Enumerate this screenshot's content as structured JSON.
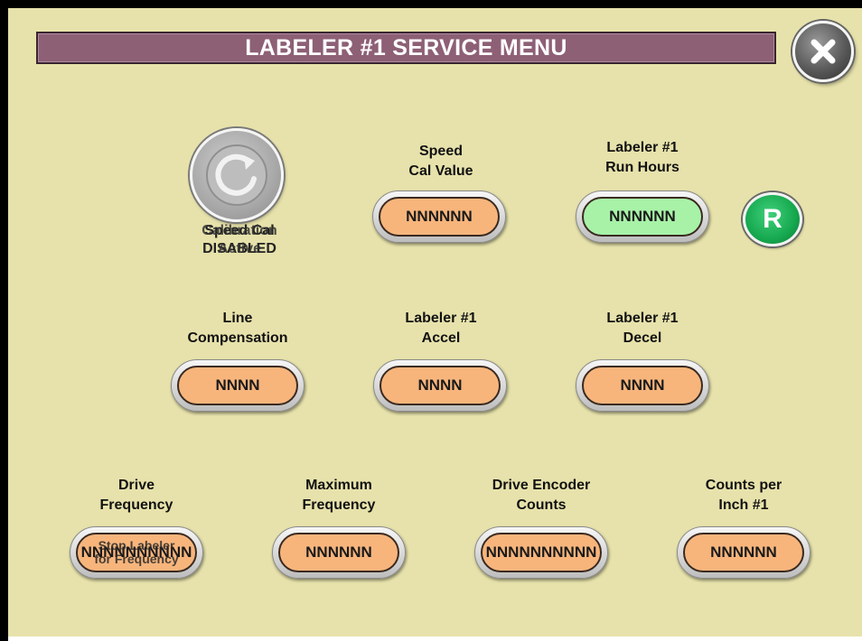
{
  "title": "LABELER #1 SERVICE MENU",
  "close_icon": "close-x-icon",
  "calibration": {
    "icon": "refresh-icon",
    "text_a": "Speed Cal\nDISABLED",
    "text_b": "Calibration\nActive"
  },
  "reset_button_label": "R",
  "fields": {
    "speed_cal": {
      "label": "Speed\nCal Value",
      "value": "NNNNNN"
    },
    "run_hours": {
      "label": "Labeler #1\nRun Hours",
      "value": "NNNNNN"
    },
    "line_comp": {
      "label": "Line\nCompensation",
      "value": "NNNN"
    },
    "accel": {
      "label": "Labeler #1\nAccel",
      "value": "NNNN"
    },
    "decel": {
      "label": "Labeler #1\nDecel",
      "value": "NNNN"
    },
    "drive_freq": {
      "label": "Drive\nFrequency",
      "value": "NNNNNNNNNN",
      "overlay": "Stop Labeler\nfor Frequency"
    },
    "max_freq": {
      "label": "Maximum\nFrequency",
      "value": "NNNNNN"
    },
    "encoder_counts": {
      "label": "Drive Encoder\nCounts",
      "value": "NNNNNNNNNN"
    },
    "counts_per_inch": {
      "label": "Counts per\nInch #1",
      "value": "NNNNNN"
    }
  },
  "colors": {
    "background": "#e7e2ab",
    "titlebar": "#8d6076",
    "field_orange": "#f7b57c",
    "field_green": "#a8f2a8",
    "reset_green": "#16a84f"
  }
}
